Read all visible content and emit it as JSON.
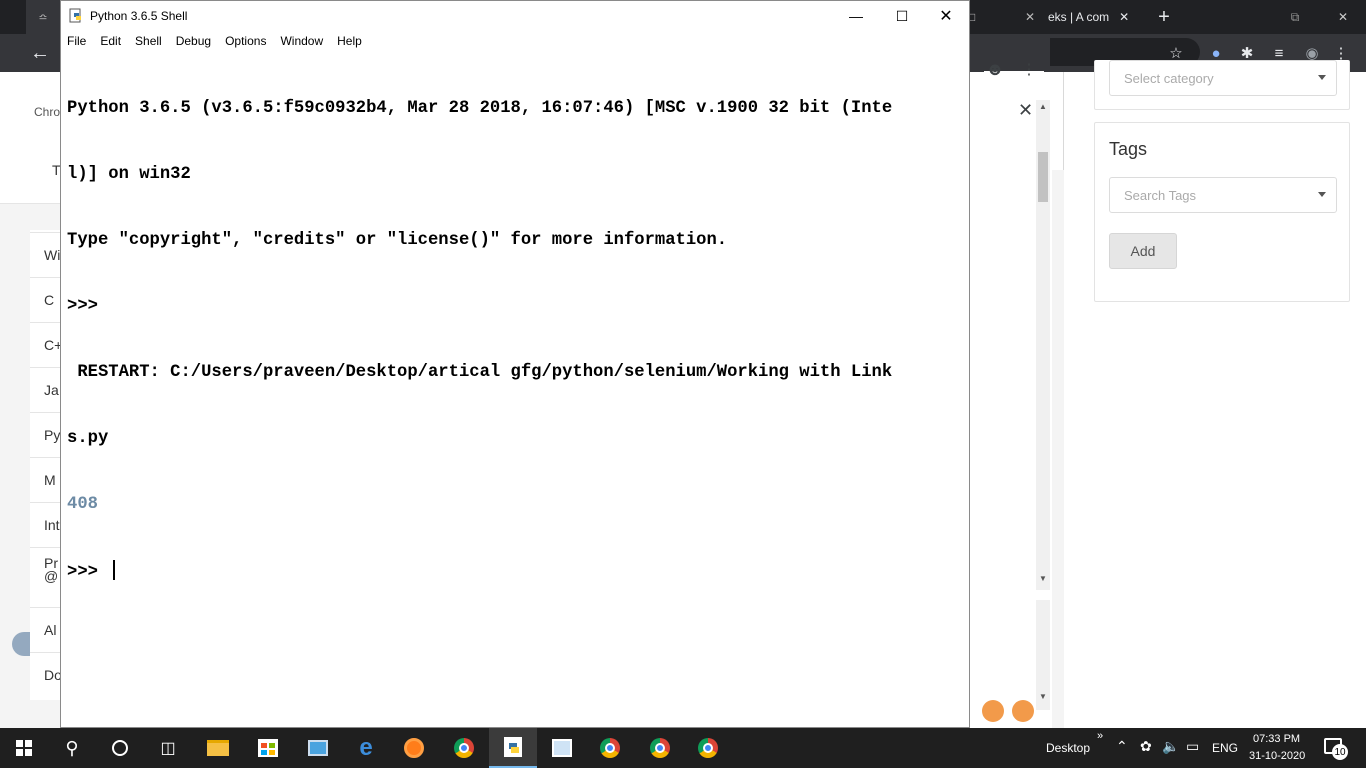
{
  "idle": {
    "title": "Python 3.6.5 Shell",
    "menu": [
      "File",
      "Edit",
      "Shell",
      "Debug",
      "Options",
      "Window",
      "Help"
    ],
    "lines": [
      "Python 3.6.5 (v3.6.5:f59c0932b4, Mar 28 2018, 16:07:46) [MSC v.1900 32 bit (Inte",
      "l)] on win32",
      "Type \"copyright\", \"credits\" or \"license()\" for more information.",
      ">>> ",
      " RESTART: C:/Users/praveen/Desktop/artical gfg/python/selenium/Working with Link",
      "s.py"
    ],
    "output": "408",
    "prompt": ">>> "
  },
  "browser": {
    "tab_text": "eks | A com",
    "bookmark_text": "Chro",
    "left_items": [
      "Wi",
      "C",
      "C+",
      "Ja",
      "Py",
      "M",
      "Int",
      "Pr",
      "Al",
      "Do"
    ],
    "left_item_extra": "@",
    "top_left_text": "T",
    "category_placeholder": "Select category",
    "tags_title": "Tags",
    "tags_placeholder": "Search Tags",
    "add_label": "Add"
  },
  "taskbar": {
    "desktop_label": "Desktop",
    "lang": "ENG",
    "time": "07:33 PM",
    "date": "31-10-2020",
    "notification_count": "10"
  },
  "colors": {
    "shell_output": "#6d8ba5",
    "taskbar": "#1f1f1f",
    "chrome_dark": "#35363a"
  }
}
